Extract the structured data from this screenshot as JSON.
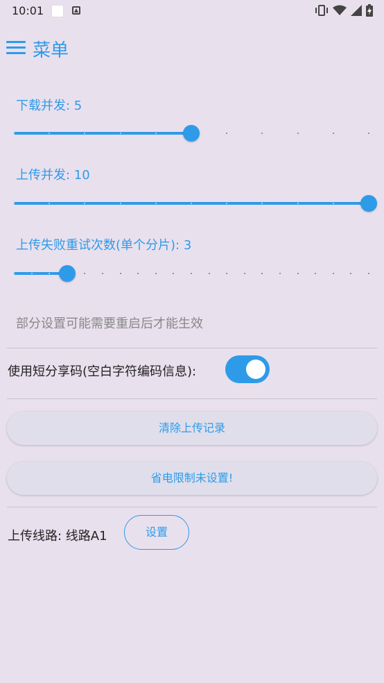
{
  "status_bar": {
    "time": "10:01",
    "left_icons": [
      "white-square-icon",
      "a-badge-icon"
    ],
    "right_icons": [
      "vibrate-icon",
      "wifi-icon",
      "signal-icon",
      "battery-charging-icon"
    ]
  },
  "app_bar": {
    "title": "菜单",
    "menu_icon": "hamburger-menu-icon"
  },
  "sliders": [
    {
      "label": "下载并发: 5",
      "value": 5,
      "min": 0,
      "max": 10
    },
    {
      "label": "上传并发: 10",
      "value": 10,
      "min": 0,
      "max": 10
    },
    {
      "label": "上传失败重试次数(单个分片): 3",
      "value": 3,
      "min": 0,
      "max": 20
    }
  ],
  "hint": "部分设置可能需要重启后才能生效",
  "short_code": {
    "label": "使用短分享码(空白字符编码信息):",
    "enabled": true
  },
  "buttons": {
    "clear_upload": "清除上传记录",
    "battery": "省电限制未设置!"
  },
  "route": {
    "label": "上传线路: 线路A1",
    "button": "设置"
  },
  "colors": {
    "accent": "#2e9be8",
    "background": "#e9e0ee",
    "hint": "#888888"
  }
}
